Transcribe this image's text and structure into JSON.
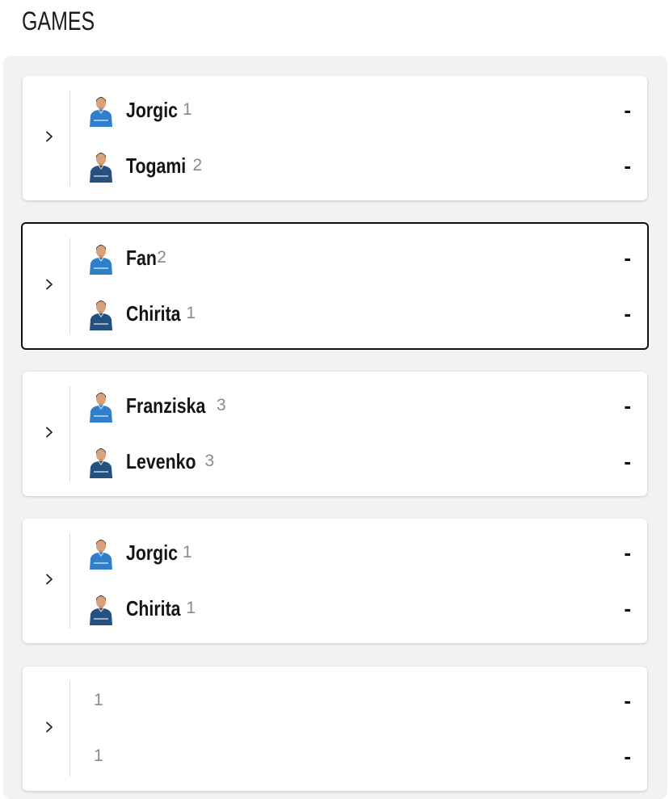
{
  "header": {
    "title": "GAMES"
  },
  "games": [
    {
      "players": [
        {
          "name": "Jorgic",
          "seed": "1",
          "score": "-",
          "kit": "light"
        },
        {
          "name": "Togami",
          "seed": "2",
          "score": "-",
          "kit": "dark"
        }
      ]
    },
    {
      "selected": true,
      "players": [
        {
          "name": "Fan",
          "seed": "2",
          "score": "-",
          "kit": "light"
        },
        {
          "name": "Chirita",
          "seed": "1",
          "score": "-",
          "kit": "dark"
        }
      ]
    },
    {
      "players": [
        {
          "name": "Franziska",
          "seed": "3",
          "score": "-",
          "kit": "light"
        },
        {
          "name": "Levenko",
          "seed": "3",
          "score": "-",
          "kit": "dark"
        }
      ]
    },
    {
      "players": [
        {
          "name": "Jorgic",
          "seed": "1",
          "score": "-",
          "kit": "light"
        },
        {
          "name": "Chirita",
          "seed": "1",
          "score": "-",
          "kit": "dark"
        }
      ]
    },
    {
      "players": [
        {
          "name": "",
          "seed": "1",
          "score": "-",
          "kit": "none"
        },
        {
          "name": "",
          "seed": "1",
          "score": "-",
          "kit": "none"
        }
      ]
    }
  ],
  "colors": {
    "panel_bg": "#f2f2f2",
    "card_bg": "#ffffff",
    "kit_light": "#2f7fc9",
    "kit_dark": "#24517f",
    "seed_text": "#8a8a8a"
  },
  "icons": {
    "expand": "chevron-right-icon",
    "player": "player-avatar-icon"
  }
}
